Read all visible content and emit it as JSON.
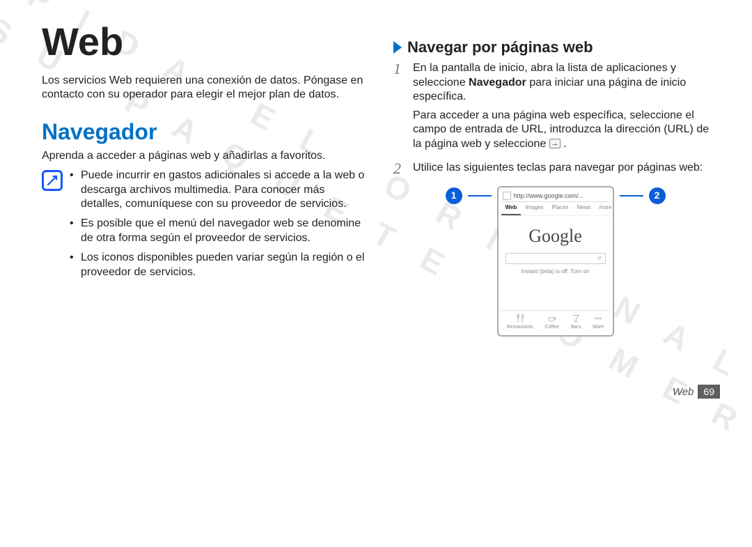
{
  "watermark": "P I D A   E L   O R I G I N A L\nC O N   S U   P A Q U E T E   C O M E R C I A L",
  "left": {
    "title": "Web",
    "intro": "Los servicios Web requieren una conexión de datos. Póngase en contacto con su operador para elegir el mejor plan de datos.",
    "section": "Navegador",
    "subtitle": "Aprenda a acceder a páginas web y añadirlas a favoritos.",
    "bullets": [
      "Puede incurrir en gastos adicionales si accede a la web o descarga archivos multimedia. Para conocer más detalles, comuníquese con su proveedor de servicios.",
      "Es posible que el menú del navegador web se denomine de otra forma según el proveedor de servicios.",
      "Los iconos disponibles pueden variar según la región o el proveedor de servicios."
    ]
  },
  "right": {
    "subheading": "Navegar por páginas web",
    "step1_num": "1",
    "step1_a": "En la pantalla de inicio, abra la lista de aplicaciones y seleccione ",
    "step1_bold": "Navegador",
    "step1_b": " para iniciar una página de inicio específica.",
    "step1_c": "Para acceder a una página web específica, seleccione el campo de entrada de URL, introduzca la dirección (URL) de la página web y seleccione ",
    "step2_num": "2",
    "step2": "Utilice las siguientes teclas para navegar por páginas web:",
    "callouts": {
      "c1": "1",
      "c2": "2"
    },
    "phone": {
      "url": "http://www.google.com/...",
      "tabs": [
        "Web",
        "Images",
        "Places",
        "News",
        "more"
      ],
      "logo": "Google",
      "instant_a": "Instant (beta) is off: ",
      "instant_b": "Turn on",
      "appbar": [
        "Restaurants",
        "Coffee",
        "Bars",
        "More"
      ]
    }
  },
  "footer": {
    "section": "Web",
    "page": "69"
  }
}
